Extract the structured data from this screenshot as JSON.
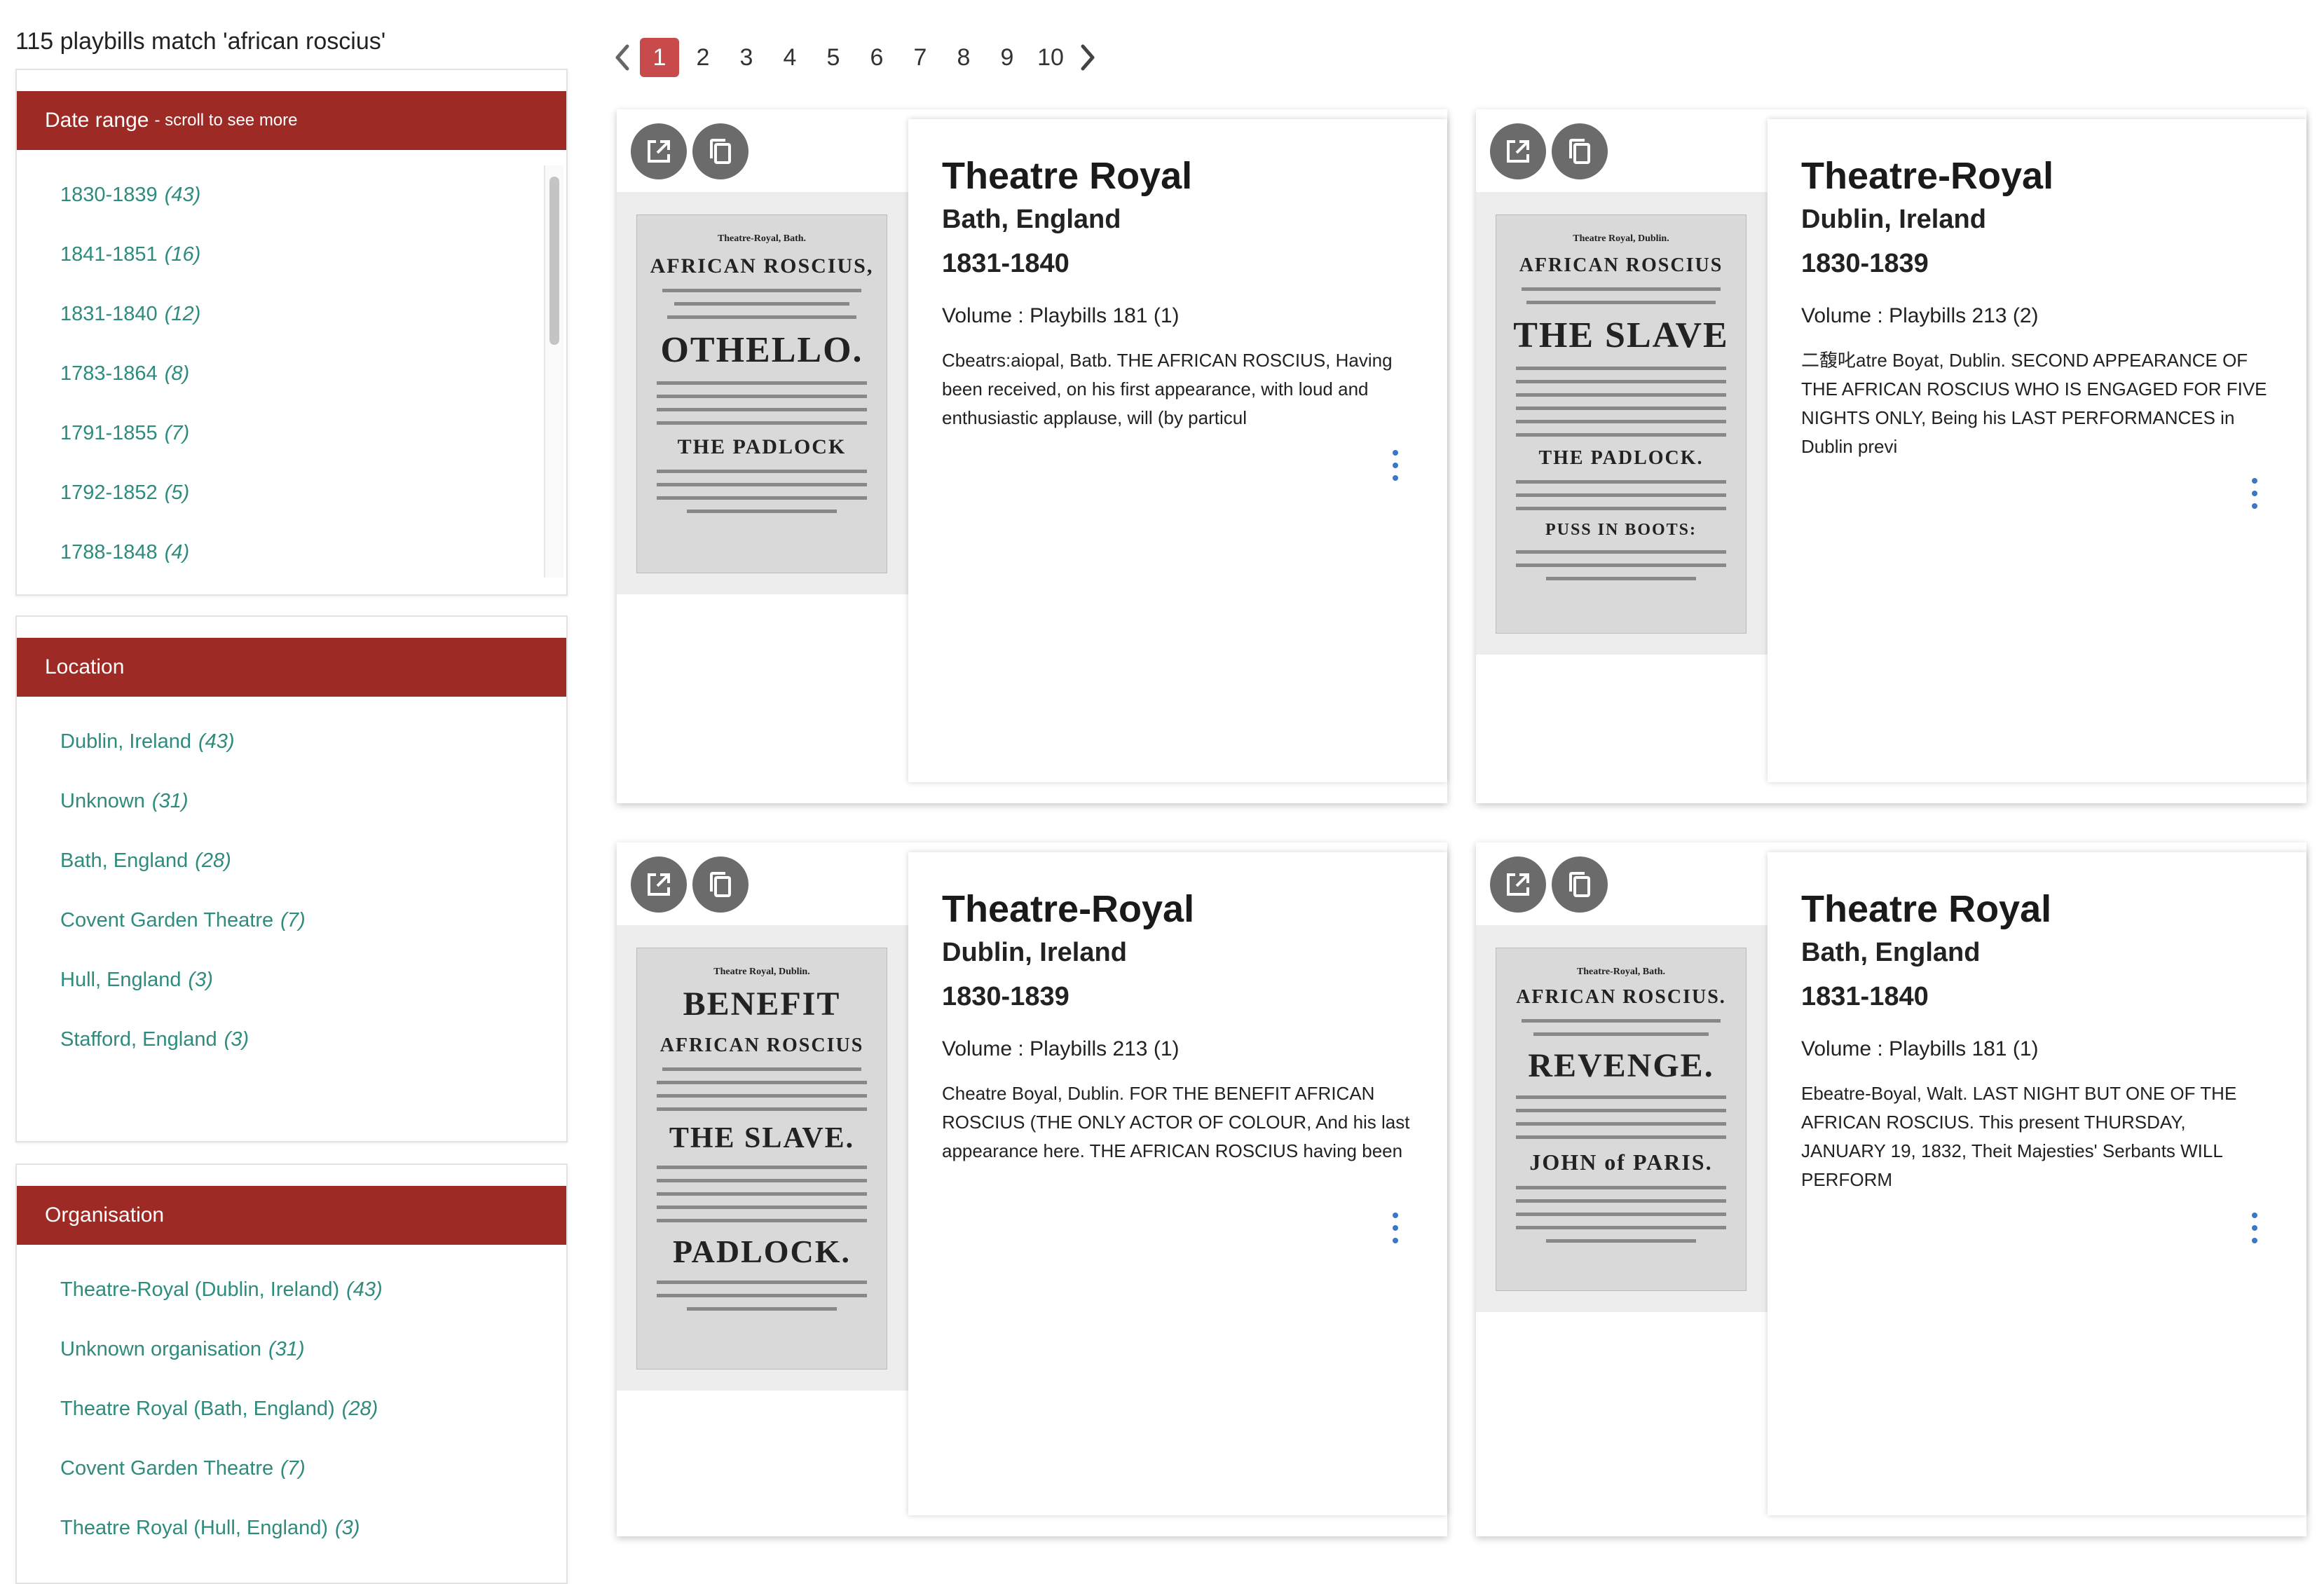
{
  "results": {
    "summary": "115 playbills match 'african roscius'"
  },
  "facets": {
    "date": {
      "title": "Date range",
      "hint": "- scroll to see more",
      "items": [
        {
          "label": "1830-1839",
          "count": "(43)"
        },
        {
          "label": "1841-1851",
          "count": "(16)"
        },
        {
          "label": "1831-1840",
          "count": "(12)"
        },
        {
          "label": "1783-1864",
          "count": "(8)"
        },
        {
          "label": "1791-1855",
          "count": "(7)"
        },
        {
          "label": "1792-1852",
          "count": "(5)"
        },
        {
          "label": "1788-1848",
          "count": "(4)"
        }
      ]
    },
    "location": {
      "title": "Location",
      "items": [
        {
          "label": "Dublin, Ireland",
          "count": "(43)"
        },
        {
          "label": "Unknown",
          "count": "(31)"
        },
        {
          "label": "Bath, England",
          "count": "(28)"
        },
        {
          "label": "Covent Garden Theatre",
          "count": "(7)"
        },
        {
          "label": "Hull, England",
          "count": "(3)"
        },
        {
          "label": "Stafford, England",
          "count": "(3)"
        }
      ]
    },
    "organisation": {
      "title": "Organisation",
      "items": [
        {
          "label": "Theatre-Royal (Dublin, Ireland)",
          "count": "(43)"
        },
        {
          "label": "Unknown organisation",
          "count": "(31)"
        },
        {
          "label": "Theatre Royal (Bath, England)",
          "count": "(28)"
        },
        {
          "label": "Covent Garden Theatre",
          "count": "(7)"
        },
        {
          "label": "Theatre Royal (Hull, England)",
          "count": "(3)"
        }
      ]
    }
  },
  "pagination": {
    "prev_icon": "chevron-left-icon",
    "next_icon": "chevron-right-icon",
    "pages": [
      "1",
      "2",
      "3",
      "4",
      "5",
      "6",
      "7",
      "8",
      "9",
      "10"
    ],
    "current": "1"
  },
  "cards": [
    {
      "title": "Theatre Royal",
      "place": "Bath, England",
      "years": "1831-1840",
      "volume": "Volume : Playbills 181 (1)",
      "text": "Cbeatrs:aiopal, Batb. THE AFRICAN ROSCIUS, Having been received, on his first appearance, with loud and enthusiastic applause, will (by particul",
      "thumb": {
        "head": "Theatre-Royal, Bath.",
        "l1": "AFRICAN ROSCIUS,",
        "l2": "OTHELLO.",
        "l3": "THE PADLOCK"
      }
    },
    {
      "title": "Theatre-Royal",
      "place": "Dublin, Ireland",
      "years": "1830-1839",
      "volume": "Volume : Playbills 213 (2)",
      "text": "二馥叱atre Boyat, Dublin. SECOND APPEARANCE OF THE AFRICAN ROSCIUS WHO IS ENGAGED FOR FIVE NIGHTS ONLY, Being his LAST PERFORMANCES in Dublin previ",
      "thumb": {
        "head": "Theatre Royal, Dublin.",
        "l1": "AFRICAN ROSCIUS",
        "l2": "THE SLAVE",
        "l3": "PUSS IN BOOTS:"
      }
    },
    {
      "title": "Theatre-Royal",
      "place": "Dublin, Ireland",
      "years": "1830-1839",
      "volume": "Volume : Playbills 213 (1)",
      "text": "Cheatre Boyal, Dublin. FOR THE BENEFIT AFRICAN ROSCIUS (THE ONLY ACTOR OF COLOUR, And his last appearance here. THE AFRICAN ROSCIUS having been",
      "thumb": {
        "head": "Theatre Royal, Dublin.",
        "l1": "BENEFIT",
        "l2": "THE SLAVE.",
        "l3": "PADLOCK."
      }
    },
    {
      "title": "Theatre Royal",
      "place": "Bath, England",
      "years": "1831-1840",
      "volume": "Volume : Playbills 181 (1)",
      "text": "Ebeatre-Boyal, Walt. LAST NIGHT BUT ONE OF THE AFRICAN ROSCIUS. This present THURSDAY, JANUARY 19, 1832, Theit Majesties' Serbants WILL PERFORM",
      "thumb": {
        "head": "Theatre-Royal, Bath.",
        "l1": "AFRICAN ROSCIUS.",
        "l2": "REVENGE.",
        "l3": "JOHN of PARIS."
      }
    }
  ],
  "icons": {
    "open": "open-in-new-icon",
    "copy": "copy-icon",
    "menu": "more-vert-icon"
  },
  "colors": {
    "accent": "#9d2a24",
    "link": "#2e8b7d",
    "page_active": "#c94a4a",
    "menu_dots": "#3b78c4"
  }
}
